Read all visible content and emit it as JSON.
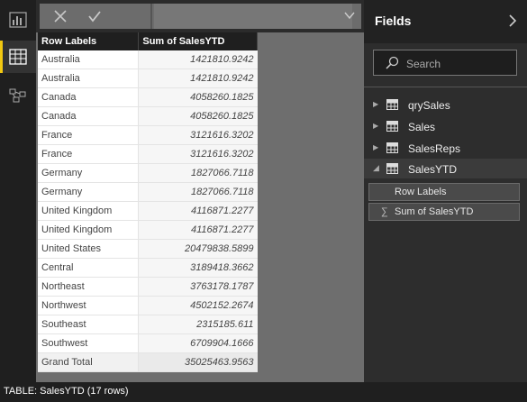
{
  "formula_bar": {
    "value": ""
  },
  "table": {
    "headers": [
      "Row Labels",
      "Sum of SalesYTD"
    ],
    "rows": [
      [
        "Australia",
        "1421810.9242"
      ],
      [
        "Australia",
        "1421810.9242"
      ],
      [
        "Canada",
        "4058260.1825"
      ],
      [
        "Canada",
        "4058260.1825"
      ],
      [
        "France",
        "3121616.3202"
      ],
      [
        "France",
        "3121616.3202"
      ],
      [
        "Germany",
        "1827066.7118"
      ],
      [
        "Germany",
        "1827066.7118"
      ],
      [
        "United Kingdom",
        "4116871.2277"
      ],
      [
        "United Kingdom",
        "4116871.2277"
      ],
      [
        "United States",
        "20479838.5899"
      ],
      [
        "Central",
        "3189418.3662"
      ],
      [
        "Northeast",
        "3763178.1787"
      ],
      [
        "Northwest",
        "4502152.2674"
      ],
      [
        "Southeast",
        "2315185.611"
      ],
      [
        "Southwest",
        "6709904.1666"
      ]
    ],
    "total": [
      "Grand Total",
      "35025463.9563"
    ]
  },
  "fields_pane": {
    "title": "Fields",
    "search_placeholder": "Search",
    "tables": [
      {
        "name": "qrySales",
        "expanded": false
      },
      {
        "name": "Sales",
        "expanded": false
      },
      {
        "name": "SalesReps",
        "expanded": false
      },
      {
        "name": "SalesYTD",
        "expanded": true
      }
    ],
    "chips": [
      "Row Labels",
      "Sum of SalesYTD"
    ],
    "sigma": "∑"
  },
  "status_bar": {
    "text": "TABLE: SalesYTD (17 rows)"
  },
  "colors": {
    "accent": "#f2c811",
    "canvas": "#6e6e6e",
    "panel": "#2d2d2d"
  }
}
